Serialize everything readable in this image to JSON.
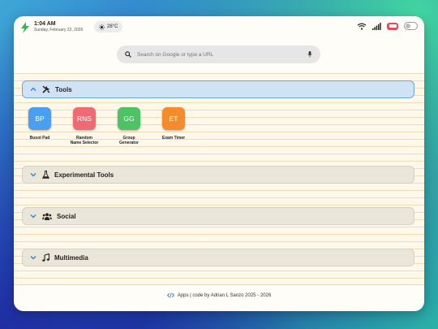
{
  "status": {
    "time": "1:04 AM",
    "date": "Sunday, February 22, 2026",
    "weather": "28°C"
  },
  "search": {
    "placeholder": "Search on Google or type a URL"
  },
  "sections": [
    {
      "title": "Tools",
      "expanded": true,
      "icon": "tools-icon"
    },
    {
      "title": "Experimental Tools",
      "expanded": false,
      "icon": "flask-icon"
    },
    {
      "title": "Social",
      "expanded": false,
      "icon": "users-icon"
    },
    {
      "title": "Multimedia",
      "expanded": false,
      "icon": "music-icon"
    }
  ],
  "apps": [
    {
      "abbr": "BP",
      "label": "Busot Pad",
      "color": "#4a9ff0"
    },
    {
      "abbr": "RNS",
      "label": "Random\nName Selector",
      "color": "#ef6b73"
    },
    {
      "abbr": "GG",
      "label": "Group\nGenerator",
      "color": "#4fc266"
    },
    {
      "abbr": "ET",
      "label": "Exam Timer",
      "color": "#f48c2c"
    }
  ],
  "footer": {
    "text": "Apps | code by Adrian L Sanzo 2025 - 2026"
  },
  "colors": {
    "accent": "#4a8fd8",
    "battery": "#e8495b"
  }
}
